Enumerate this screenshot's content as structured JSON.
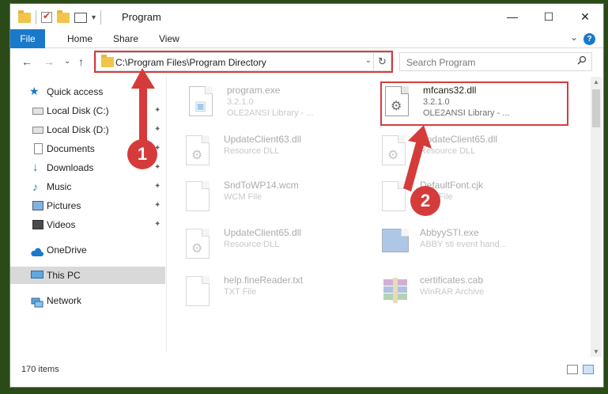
{
  "window": {
    "title": "Program",
    "minimize": "—",
    "maximize": "☐",
    "close": "✕"
  },
  "ribbon": {
    "tabs": [
      "File",
      "Home",
      "Share",
      "View"
    ],
    "help": "?",
    "expand": "⌄"
  },
  "address": {
    "path": "C:\\Program Files\\Program Directory",
    "dropdown": "⌄",
    "refresh": "↻",
    "back": "←",
    "forward": "→",
    "recent": "⌄",
    "up": "↑"
  },
  "search": {
    "placeholder": "Search Program",
    "icon": "search-icon"
  },
  "nav": {
    "items": [
      {
        "label": "Quick access",
        "icon": "star-icon",
        "pinned": false
      },
      {
        "label": "Local Disk (C:)",
        "icon": "drive-icon",
        "pinned": true
      },
      {
        "label": "Local Disk (D:)",
        "icon": "drive-icon",
        "pinned": true
      },
      {
        "label": "Documents",
        "icon": "documents-icon",
        "pinned": true
      },
      {
        "label": "Downloads",
        "icon": "download-arrow-icon",
        "pinned": true
      },
      {
        "label": "Music",
        "icon": "music-note-icon",
        "pinned": true
      },
      {
        "label": "Pictures",
        "icon": "pictures-icon",
        "pinned": true
      },
      {
        "label": "Videos",
        "icon": "video-icon",
        "pinned": true
      },
      {
        "label": "OneDrive",
        "icon": "cloud-icon",
        "pinned": false
      },
      {
        "label": "This PC",
        "icon": "computer-icon",
        "pinned": false,
        "selected": true
      },
      {
        "label": "Network",
        "icon": "network-icon",
        "pinned": false
      }
    ],
    "pin_glyph": "📌"
  },
  "files": [
    {
      "name": "program.exe",
      "line1": "3.2.1.0",
      "line2": "OLE2ANSI Library - ...",
      "faded": true
    },
    {
      "name": "mfcans32.dll",
      "line1": "3.2.1.0",
      "line2": "OLE2ANSI Library - ...",
      "faded": false,
      "highlighted": true
    },
    {
      "name": "UpdateClient63.dll",
      "line1": "Resource DLL",
      "line2": "",
      "faded": true
    },
    {
      "name": "UpdateClient65.dll",
      "line1": "Resource DLL",
      "line2": "",
      "faded": true
    },
    {
      "name": "SndToWP14.wcm",
      "line1": "WCM File",
      "line2": "",
      "faded": true
    },
    {
      "name": "DefaultFont.cjk",
      "line1": "CJK File",
      "line2": "",
      "faded": true
    },
    {
      "name": "UpdateClient65.dll",
      "line1": "Resource DLL",
      "line2": "",
      "faded": true
    },
    {
      "name": "AbbyySTI.exe",
      "line1": "ABBY sti event hand...",
      "line2": "",
      "faded": true
    },
    {
      "name": "help.fineReader.txt",
      "line1": "TXT File",
      "line2": "",
      "faded": true
    },
    {
      "name": "certificates.cab",
      "line1": "WinRAR Archive",
      "line2": "",
      "faded": true
    }
  ],
  "status": {
    "count": "170 items"
  },
  "callouts": [
    "1",
    "2"
  ],
  "colors": {
    "accent": "#1979ca",
    "highlight": "#d63b3b",
    "folder": "#f0c54a"
  }
}
